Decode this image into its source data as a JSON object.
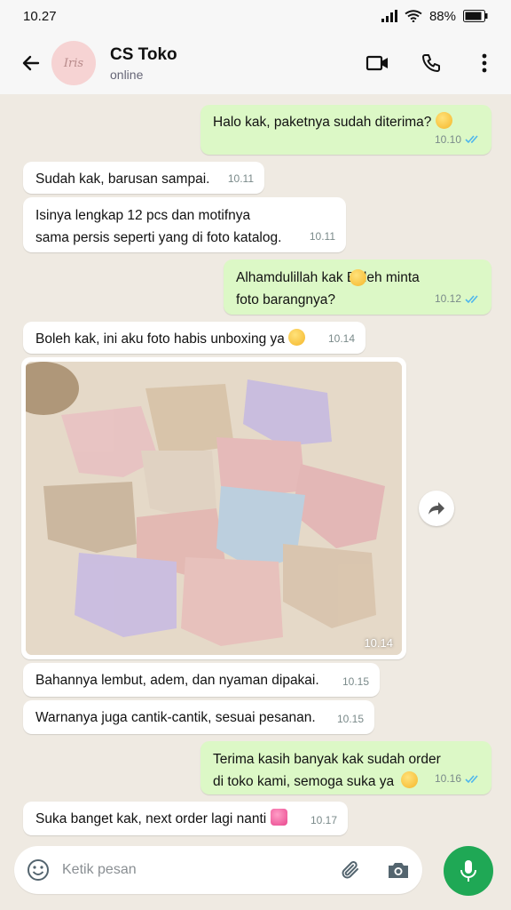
{
  "status_bar": {
    "time": "10.27",
    "battery": "88%"
  },
  "header": {
    "avatar_text": "Iris",
    "contact_name": "CS Toko",
    "contact_status": "online"
  },
  "messages": [
    {
      "dir": "out",
      "text": "Halo kak, paketnya sudah diterima?",
      "time": "10.10",
      "emoji": "smile"
    },
    {
      "dir": "in",
      "text": "Sudah kak, barusan sampai.",
      "time": "10.11"
    },
    {
      "dir": "in",
      "text": "Isinya lengkap 12 pcs dan motifnya\nsama persis seperti yang di foto katalog.",
      "time": "10.11"
    },
    {
      "dir": "out",
      "text": "Alhamdulillah kak  Boleh minta\nfoto barangnya?",
      "time": "10.12",
      "emoji": "smile"
    },
    {
      "dir": "in",
      "text": "Boleh kak, ini aku foto habis unboxing ya",
      "time": "10.14",
      "emoji": "heart-eyes"
    },
    {
      "dir": "in",
      "type": "image",
      "time": "10.14"
    },
    {
      "dir": "in",
      "text": "Bahannya lembut, adem, dan nyaman dipakai.",
      "time": "10.15"
    },
    {
      "dir": "in",
      "text": "Warnanya juga cantik-cantik, sesuai pesanan.",
      "time": "10.15"
    },
    {
      "dir": "out",
      "text": "Terima kasih banyak kak sudah order\ndi toko kami, semoga suka ya",
      "time": "10.16",
      "emoji": "hearts-face"
    },
    {
      "dir": "in",
      "text": "Suka banget kak, next order lagi nanti",
      "time": "10.17",
      "emoji": "sparkle-heart"
    }
  ],
  "input": {
    "placeholder": "Ketik pesan"
  },
  "colors": {
    "outgoing": "#dcf8c6",
    "incoming": "#ffffff",
    "accent": "#1fa855",
    "read_ticks": "#4fb6ec"
  }
}
